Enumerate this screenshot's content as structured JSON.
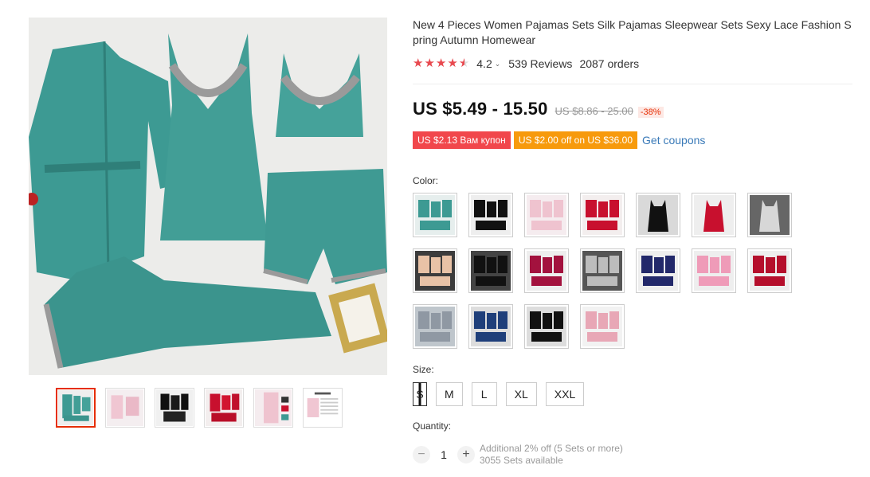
{
  "product": {
    "title": "New 4 Pieces Women Pajamas Sets Silk Pajamas Sleepwear Sets Sexy Lace Fashion Spring Autumn Homewear",
    "rating": "4.2",
    "reviews": "539 Reviews",
    "orders": "2087 orders",
    "price": "US $5.49 - 15.50",
    "original_price": "US $8.86 - 25.00",
    "discount": "-38%"
  },
  "coupons": {
    "coupon1": "US $2.13 Вам купон",
    "coupon2": "US $2.00 off on US $36.00",
    "get_coupons": "Get coupons"
  },
  "color": {
    "label": "Color:",
    "options": [
      "teal-4pc",
      "black-4pc",
      "pink-4pc",
      "red-4pc",
      "black-slip",
      "red-slip",
      "silver-slip",
      "champagne-set",
      "black-set",
      "wine-set",
      "grey-set",
      "navy-set",
      "pink-set",
      "red-set",
      "grey-lace-set",
      "navy-lace-set",
      "black-lace-set",
      "pink-lace-set"
    ]
  },
  "size": {
    "label": "Size:",
    "options": [
      "S",
      "M",
      "L",
      "XL",
      "XXL"
    ],
    "selected": "S"
  },
  "quantity": {
    "label": "Quantity:",
    "value": "1",
    "minus": "−",
    "plus": "+",
    "note": "Additional 2% off (5 Sets or more)",
    "available": "3055 Sets available"
  },
  "colors": {
    "teal": "#3d9a93",
    "accent_red": "#e62e04",
    "star": "#e8494f",
    "coupon_red": "#f1474c",
    "coupon_orange": "#f79a0c",
    "link_blue": "#3a7ab8"
  },
  "icons": {
    "minus": "minus-icon",
    "plus": "plus-icon",
    "star": "star-icon",
    "chevron": "chevron-down-icon"
  }
}
